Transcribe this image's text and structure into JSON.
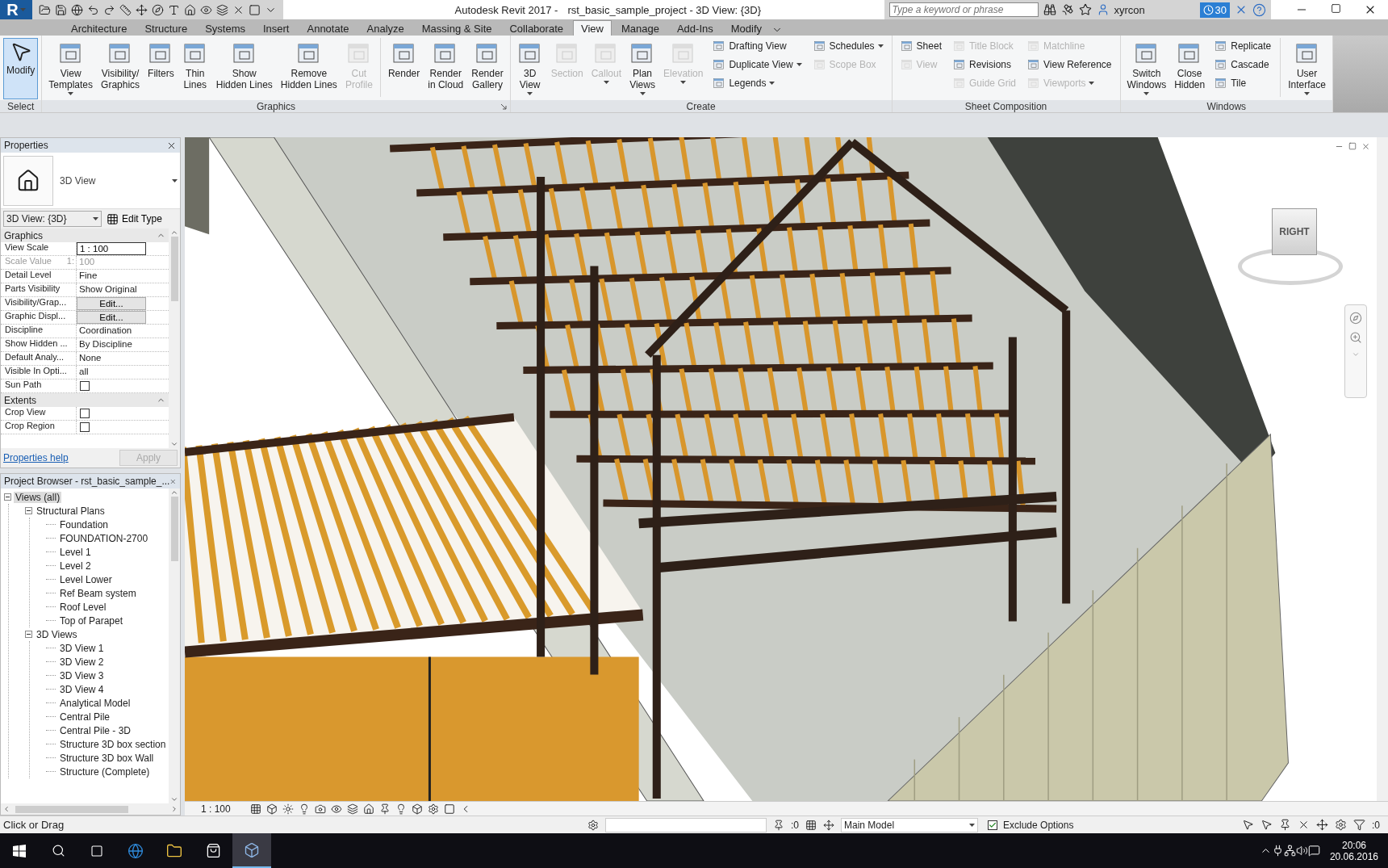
{
  "app_button": {
    "letter": "R"
  },
  "title": {
    "app": "Autodesk Revit 2017 -",
    "document": "rst_basic_sample_project - 3D View: {3D}"
  },
  "search": {
    "placeholder": "Type a keyword or phrase"
  },
  "user": {
    "name": "xyrcon"
  },
  "notifications": {
    "count": "30"
  },
  "tabs": [
    {
      "label": "Architecture",
      "selected": false
    },
    {
      "label": "Structure",
      "selected": false
    },
    {
      "label": "Systems",
      "selected": false
    },
    {
      "label": "Insert",
      "selected": false
    },
    {
      "label": "Annotate",
      "selected": false
    },
    {
      "label": "Analyze",
      "selected": false
    },
    {
      "label": "Massing & Site",
      "selected": false
    },
    {
      "label": "Collaborate",
      "selected": false
    },
    {
      "label": "View",
      "selected": true
    },
    {
      "label": "Manage",
      "selected": false
    },
    {
      "label": "Add-Ins",
      "selected": false
    },
    {
      "label": "Modify",
      "selected": false
    }
  ],
  "select_panel": {
    "title": "Select",
    "modify": {
      "label": "Modify",
      "selected": true
    }
  },
  "panels": [
    {
      "title": "Graphics",
      "launcher": true,
      "tools": [
        {
          "kind": "large",
          "label": "View\nTemplates",
          "disabled": false,
          "dropdown": true
        },
        {
          "kind": "large",
          "label": "Visibility/\nGraphics",
          "disabled": false,
          "dropdown": false
        },
        {
          "kind": "large",
          "label": "Filters",
          "disabled": false,
          "dropdown": false
        },
        {
          "kind": "large",
          "label": "Thin\nLines",
          "disabled": false,
          "dropdown": false
        },
        {
          "kind": "large",
          "label": "Show\nHidden Lines",
          "disabled": false,
          "dropdown": false
        },
        {
          "kind": "large",
          "label": "Remove\nHidden Lines",
          "disabled": false,
          "dropdown": false
        },
        {
          "kind": "large",
          "label": "Cut\nProfile",
          "disabled": true,
          "dropdown": false
        },
        {
          "kind": "separator"
        },
        {
          "kind": "large",
          "label": "Render",
          "disabled": false,
          "dropdown": false
        },
        {
          "kind": "large",
          "label": "Render\nin Cloud",
          "disabled": false,
          "dropdown": false
        },
        {
          "kind": "large",
          "label": "Render\nGallery",
          "disabled": false,
          "dropdown": false
        }
      ]
    },
    {
      "title": "Create",
      "launcher": false,
      "tools": [
        {
          "kind": "large",
          "label": "3D\nView",
          "disabled": false,
          "dropdown": true
        },
        {
          "kind": "large",
          "label": "Section",
          "disabled": true,
          "dropdown": false
        },
        {
          "kind": "large",
          "label": "Callout",
          "disabled": true,
          "dropdown": true
        },
        {
          "kind": "large",
          "label": "Plan\nViews",
          "disabled": false,
          "dropdown": true
        },
        {
          "kind": "large",
          "label": "Elevation",
          "disabled": true,
          "dropdown": true
        },
        {
          "kind": "stack",
          "items": [
            {
              "label": "Drafting View",
              "disabled": false,
              "dropdown": false
            },
            {
              "label": "Duplicate View",
              "disabled": false,
              "dropdown": true
            },
            {
              "label": "Legends",
              "disabled": false,
              "dropdown": true
            }
          ]
        },
        {
          "kind": "stack",
          "items": [
            {
              "label": "Schedules",
              "disabled": false,
              "dropdown": true
            },
            {
              "label": "Scope Box",
              "disabled": true,
              "dropdown": false
            }
          ]
        }
      ]
    },
    {
      "title": "Sheet Composition",
      "launcher": false,
      "tools": [
        {
          "kind": "stack",
          "items": [
            {
              "label": "Sheet",
              "disabled": false,
              "dropdown": false
            },
            {
              "label": "View",
              "disabled": true,
              "dropdown": false
            }
          ]
        },
        {
          "kind": "stack",
          "items": [
            {
              "label": "Title Block",
              "disabled": true,
              "dropdown": false
            },
            {
              "label": "Revisions",
              "disabled": false,
              "dropdown": false
            },
            {
              "label": "Guide Grid",
              "disabled": true,
              "dropdown": false
            }
          ]
        },
        {
          "kind": "stack",
          "items": [
            {
              "label": "Matchline",
              "disabled": true,
              "dropdown": false
            },
            {
              "label": "View Reference",
              "disabled": false,
              "dropdown": false
            },
            {
              "label": "Viewports",
              "disabled": true,
              "dropdown": true
            }
          ]
        }
      ]
    },
    {
      "title": "Windows",
      "launcher": false,
      "tools": [
        {
          "kind": "large",
          "label": "Switch\nWindows",
          "disabled": false,
          "dropdown": true
        },
        {
          "kind": "large",
          "label": "Close\nHidden",
          "disabled": false,
          "dropdown": false
        },
        {
          "kind": "stack",
          "items": [
            {
              "label": "Replicate",
              "disabled": false,
              "dropdown": false
            },
            {
              "label": "Cascade",
              "disabled": false,
              "dropdown": false
            },
            {
              "label": "Tile",
              "disabled": false,
              "dropdown": false
            }
          ]
        },
        {
          "kind": "separator"
        },
        {
          "kind": "large",
          "label": "User\nInterface",
          "disabled": false,
          "dropdown": true
        }
      ]
    }
  ],
  "properties": {
    "title": "Properties",
    "type_name": "3D View",
    "instance": "3D View: {3D}",
    "edit_type": "Edit Type",
    "groups": [
      {
        "title": "Graphics",
        "rows": [
          {
            "kind": "input",
            "label": "View Scale",
            "value": "1 : 100",
            "disabled": false
          },
          {
            "kind": "text",
            "label": "Scale Value",
            "unit": "1:",
            "value": "100",
            "disabled": true
          },
          {
            "kind": "text",
            "label": "Detail Level",
            "value": "Fine",
            "disabled": false
          },
          {
            "kind": "text",
            "label": "Parts Visibility",
            "value": "Show Original",
            "disabled": false
          },
          {
            "kind": "button",
            "label": "Visibility/Grap...",
            "value": "Edit...",
            "disabled": false
          },
          {
            "kind": "button",
            "label": "Graphic Displ...",
            "value": "Edit...",
            "disabled": false
          },
          {
            "kind": "text",
            "label": "Discipline",
            "value": "Coordination",
            "disabled": false
          },
          {
            "kind": "text",
            "label": "Show Hidden ...",
            "value": "By Discipline",
            "disabled": false
          },
          {
            "kind": "text",
            "label": "Default Analy...",
            "value": "None",
            "disabled": false
          },
          {
            "kind": "text",
            "label": "Visible In Opti...",
            "value": "all",
            "disabled": false
          },
          {
            "kind": "checkbox",
            "label": "Sun Path",
            "checked": false,
            "disabled": false
          }
        ]
      },
      {
        "title": "Extents",
        "rows": [
          {
            "kind": "checkbox",
            "label": "Crop View",
            "checked": false,
            "disabled": false
          },
          {
            "kind": "checkbox",
            "label": "Crop Region",
            "checked": false,
            "disabled": false
          }
        ]
      }
    ],
    "help": "Properties help",
    "apply": {
      "label": "Apply",
      "disabled": true
    }
  },
  "project_browser": {
    "title": "Project Browser - rst_basic_sample_...",
    "tree": [
      {
        "label": "Views (all)",
        "selected": true,
        "expanded": true,
        "children": [
          {
            "label": "Structural Plans",
            "selected": false,
            "expanded": true,
            "children": [
              {
                "label": "Foundation",
                "selected": false
              },
              {
                "label": "FOUNDATION-2700",
                "selected": false
              },
              {
                "label": "Level 1",
                "selected": false
              },
              {
                "label": "Level 2",
                "selected": false
              },
              {
                "label": "Level Lower",
                "selected": false
              },
              {
                "label": "Ref Beam system",
                "selected": false
              },
              {
                "label": "Roof Level",
                "selected": false
              },
              {
                "label": "Top of Parapet",
                "selected": false
              }
            ]
          },
          {
            "label": "3D Views",
            "selected": false,
            "expanded": true,
            "children": [
              {
                "label": "3D View 1",
                "selected": false
              },
              {
                "label": "3D View 2",
                "selected": false
              },
              {
                "label": "3D View 3",
                "selected": false
              },
              {
                "label": "3D View 4",
                "selected": false
              },
              {
                "label": "Analytical Model",
                "selected": false
              },
              {
                "label": "Central Pile",
                "selected": false
              },
              {
                "label": "Central Pile - 3D",
                "selected": false
              },
              {
                "label": "Structure 3D box section",
                "selected": false
              },
              {
                "label": "Structure 3D box Wall",
                "selected": false
              },
              {
                "label": "Structure (Complete)",
                "selected": false
              }
            ]
          }
        ]
      }
    ]
  },
  "viewport": {
    "view_cube": "RIGHT",
    "scale": "1 : 100"
  },
  "status_bar": {
    "message": "Click or Drag",
    "worksets_count": ":0",
    "design_option": "Main Model",
    "exclude_options": {
      "label": "Exclude Options",
      "checked": true
    },
    "filter_count": ":0"
  },
  "taskbar": {
    "time": "20:06",
    "date": "20.06.2016"
  }
}
